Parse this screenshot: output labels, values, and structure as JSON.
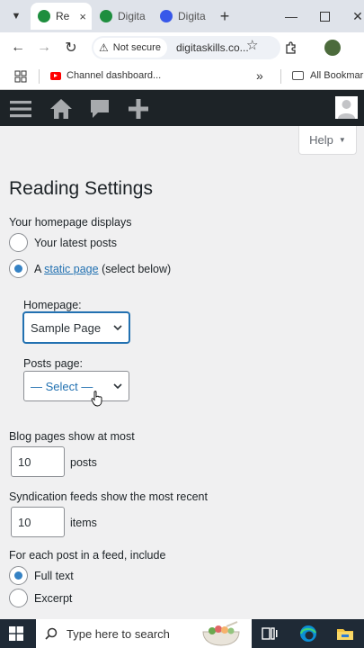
{
  "browser": {
    "tabs": [
      {
        "title": "Re",
        "active": true,
        "favicon_color": "#1e8e3e"
      },
      {
        "title": "Digita",
        "active": false,
        "favicon_color": "#1e8e3e"
      },
      {
        "title": "Digita",
        "active": false,
        "favicon_color": "#3858e9"
      }
    ],
    "tab_close_glyph": "×",
    "new_tab_glyph": "+",
    "security_label": "Not secure",
    "url": "digitaskills.co...",
    "bookmarks": [
      {
        "label": "Channel dashboard..."
      },
      {
        "label": "All Bookmarks"
      }
    ],
    "bookmarks_overflow": "»"
  },
  "wp_admin": {
    "icons": [
      "menu-icon",
      "home-icon",
      "comments-icon",
      "add-new-icon",
      "avatar-icon"
    ]
  },
  "page": {
    "help_label": "Help",
    "title": "Reading Settings",
    "homepage_displays": {
      "label": "Your homepage displays",
      "options": [
        {
          "label": "Your latest posts",
          "checked": false
        },
        {
          "label_prefix": "A ",
          "link_text": "static page",
          "label_suffix": " (select below)",
          "checked": true
        }
      ]
    },
    "homepage_select": {
      "label": "Homepage:",
      "value": "Sample Page"
    },
    "posts_page_select": {
      "label": "Posts page:",
      "value": "— Select —"
    },
    "blog_pages": {
      "label": "Blog pages show at most",
      "value": "10",
      "suffix": "posts"
    },
    "syndication": {
      "label": "Syndication feeds show the most recent",
      "value": "10",
      "suffix": "items"
    },
    "feed_include": {
      "label": "For each post in a feed, include",
      "options": [
        {
          "label": "Full text",
          "checked": true
        },
        {
          "label": "Excerpt",
          "checked": false
        }
      ]
    }
  },
  "taskbar": {
    "search_placeholder": "Type here to search"
  },
  "colors": {
    "accent": "#2271b1",
    "radio_dot": "#3582c4",
    "admin_bar": "#1d2327"
  }
}
